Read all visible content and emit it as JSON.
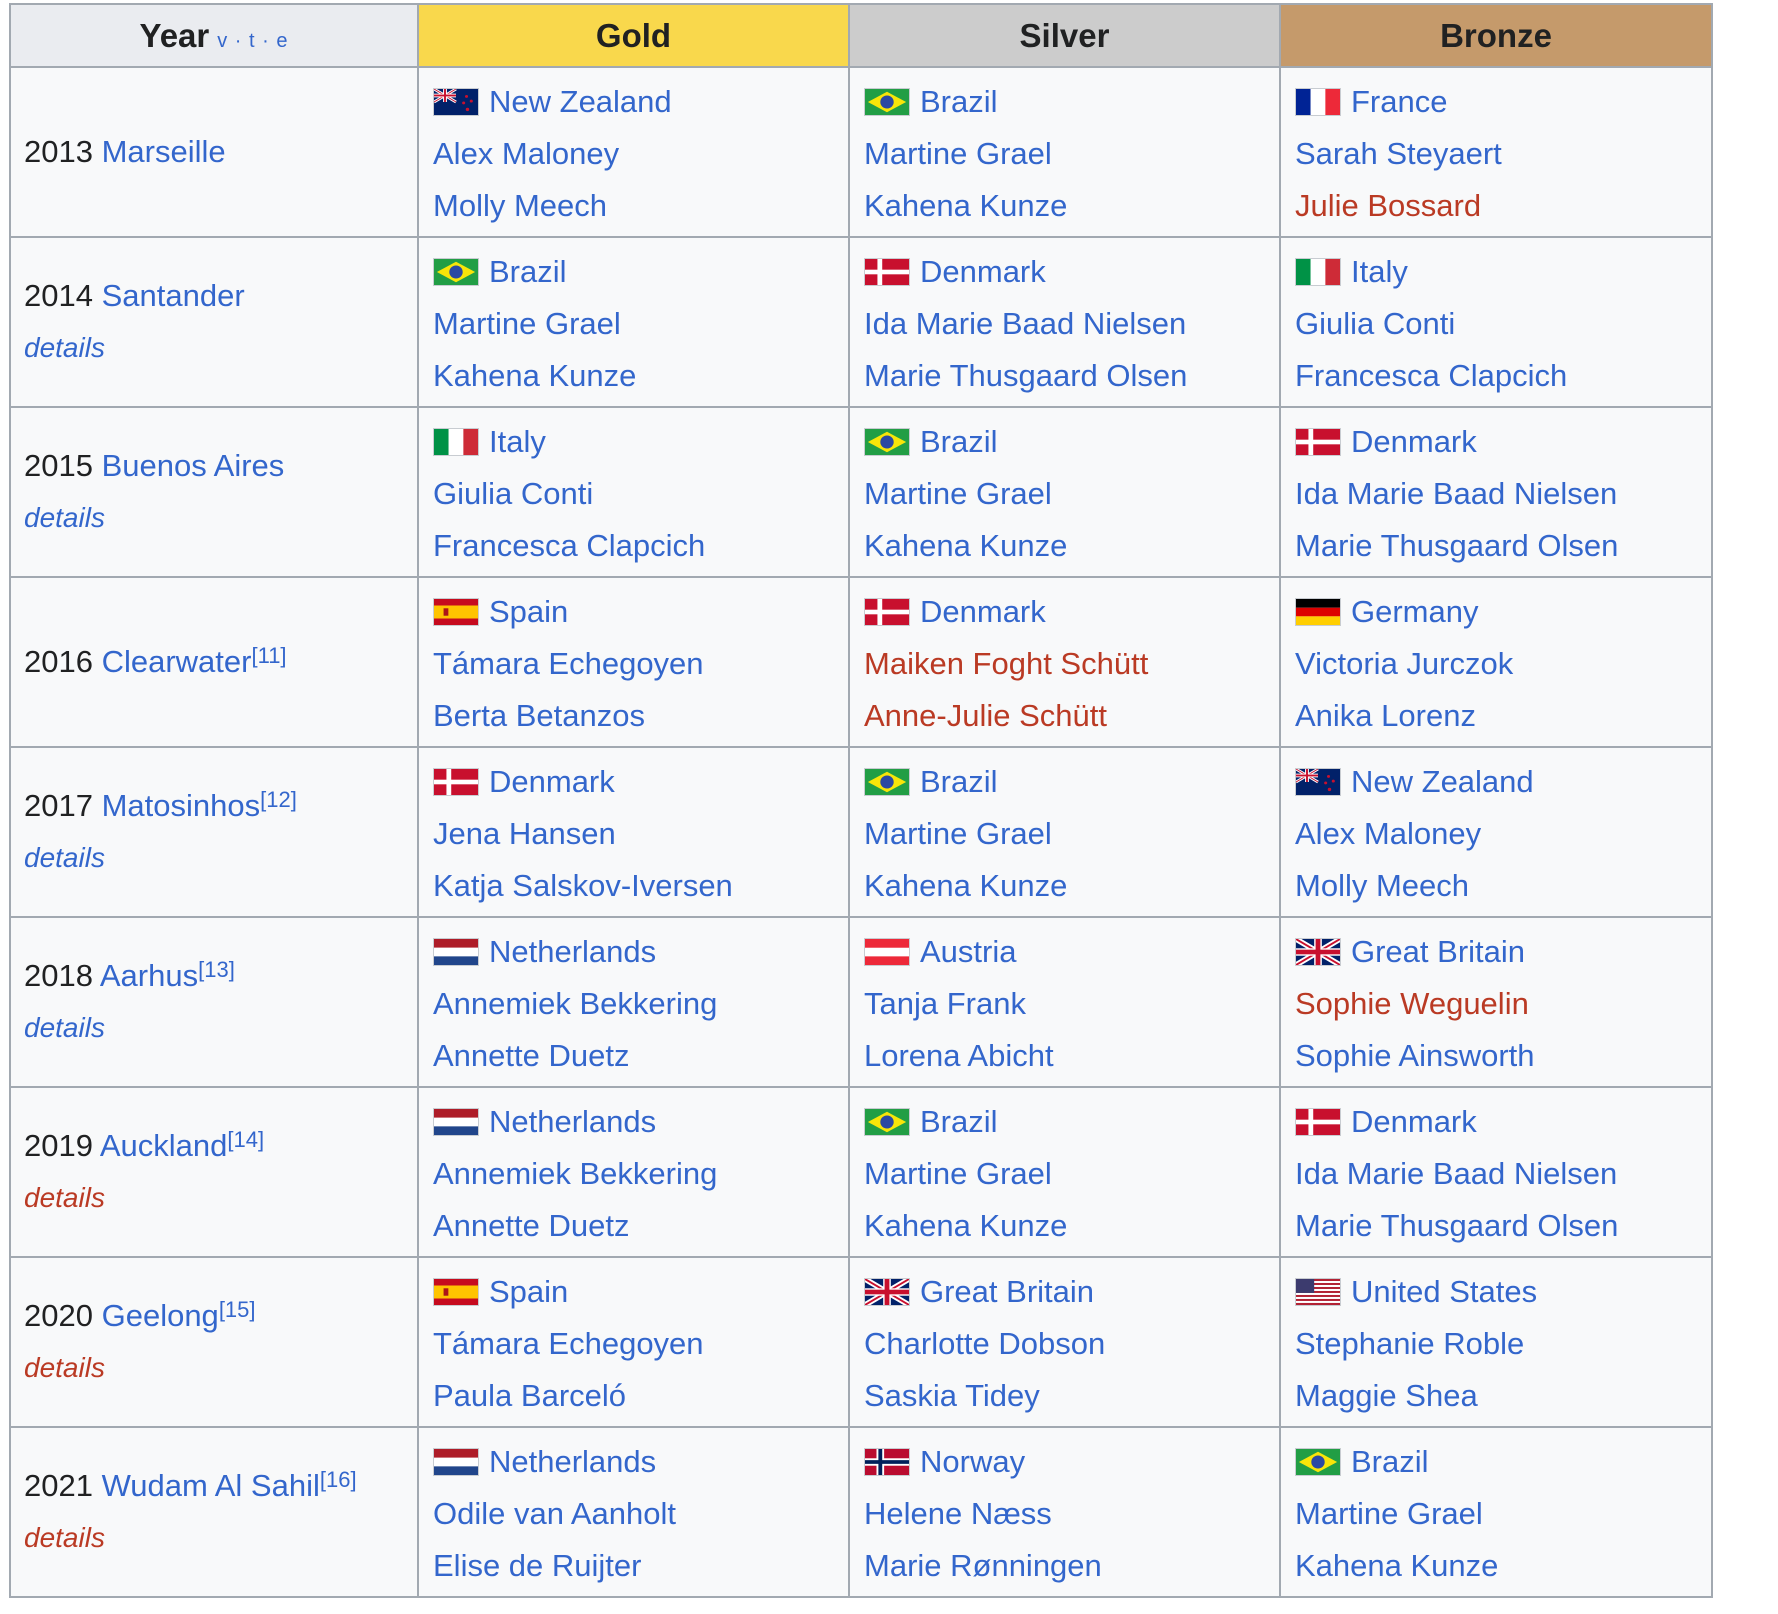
{
  "header": {
    "year": "Year",
    "vte": "v · t · e",
    "gold": "Gold",
    "silver": "Silver",
    "bronze": "Bronze"
  },
  "rows": [
    {
      "year": "2013",
      "city": "Marseille",
      "ref": "",
      "details": "",
      "details_red": false,
      "gold": {
        "country": "New Zealand",
        "flag": "new-zealand-flag",
        "a1": "Alex Maloney",
        "a2": "Molly Meech"
      },
      "silver": {
        "country": "Brazil",
        "flag": "brazil-flag",
        "a1": "Martine Grael",
        "a2": "Kahena Kunze"
      },
      "bronze": {
        "country": "France",
        "flag": "france-flag",
        "a1": "Sarah Steyaert",
        "a2": "Julie Bossard",
        "a2_red": true
      }
    },
    {
      "year": "2014",
      "city": "Santander",
      "ref": "",
      "details": "details",
      "details_red": false,
      "gold": {
        "country": "Brazil",
        "flag": "brazil-flag",
        "a1": "Martine Grael",
        "a2": "Kahena Kunze"
      },
      "silver": {
        "country": "Denmark",
        "flag": "denmark-flag",
        "a1": "Ida Marie Baad Nielsen",
        "a2": "Marie Thusgaard Olsen"
      },
      "bronze": {
        "country": "Italy",
        "flag": "italy-flag",
        "a1": "Giulia Conti",
        "a2": "Francesca Clapcich"
      }
    },
    {
      "year": "2015",
      "city": "Buenos Aires",
      "ref": "",
      "details": "details",
      "details_red": false,
      "gold": {
        "country": "Italy",
        "flag": "italy-flag",
        "a1": "Giulia Conti",
        "a2": "Francesca Clapcich"
      },
      "silver": {
        "country": "Brazil",
        "flag": "brazil-flag",
        "a1": "Martine Grael",
        "a2": "Kahena Kunze"
      },
      "bronze": {
        "country": "Denmark",
        "flag": "denmark-flag",
        "a1": "Ida Marie Baad Nielsen",
        "a2": "Marie Thusgaard Olsen"
      }
    },
    {
      "year": "2016",
      "city": "Clearwater",
      "ref": "[11]",
      "details": "",
      "details_red": false,
      "gold": {
        "country": "Spain",
        "flag": "spain-flag",
        "a1": "Támara Echegoyen",
        "a2": "Berta Betanzos"
      },
      "silver": {
        "country": "Denmark",
        "flag": "denmark-flag",
        "a1": "Maiken Foght Schütt",
        "a2": "Anne-Julie Schütt",
        "a1_red": true,
        "a2_red": true
      },
      "bronze": {
        "country": "Germany",
        "flag": "germany-flag",
        "a1": "Victoria Jurczok",
        "a2": "Anika Lorenz"
      }
    },
    {
      "year": "2017",
      "city": "Matosinhos",
      "ref": "[12]",
      "details": "details",
      "details_red": false,
      "gold": {
        "country": "Denmark",
        "flag": "denmark-flag",
        "a1": "Jena Hansen",
        "a2": "Katja Salskov-Iversen"
      },
      "silver": {
        "country": "Brazil",
        "flag": "brazil-flag",
        "a1": "Martine Grael",
        "a2": "Kahena Kunze"
      },
      "bronze": {
        "country": "New Zealand",
        "flag": "new-zealand-flag",
        "a1": "Alex Maloney",
        "a2": "Molly Meech"
      }
    },
    {
      "year": "2018",
      "city": "Aarhus",
      "ref": "[13]",
      "details": "details",
      "details_red": false,
      "gold": {
        "country": "Netherlands",
        "flag": "netherlands-flag",
        "a1": "Annemiek Bekkering",
        "a2": "Annette Duetz"
      },
      "silver": {
        "country": "Austria",
        "flag": "austria-flag",
        "a1": "Tanja Frank",
        "a2": "Lorena Abicht"
      },
      "bronze": {
        "country": "Great Britain",
        "flag": "great-britain-flag",
        "a1": "Sophie Weguelin",
        "a2": "Sophie Ainsworth",
        "a1_red": true
      }
    },
    {
      "year": "2019",
      "city": "Auckland",
      "ref": "[14]",
      "details": "details",
      "details_red": true,
      "gold": {
        "country": "Netherlands",
        "flag": "netherlands-flag",
        "a1": "Annemiek Bekkering",
        "a2": "Annette Duetz"
      },
      "silver": {
        "country": "Brazil",
        "flag": "brazil-flag",
        "a1": "Martine Grael",
        "a2": "Kahena Kunze"
      },
      "bronze": {
        "country": "Denmark",
        "flag": "denmark-flag",
        "a1": "Ida Marie Baad Nielsen",
        "a2": "Marie Thusgaard Olsen"
      }
    },
    {
      "year": "2020",
      "city": "Geelong",
      "ref": "[15]",
      "details": "details",
      "details_red": true,
      "gold": {
        "country": "Spain",
        "flag": "spain-flag",
        "a1": "Támara Echegoyen",
        "a2": "Paula Barceló"
      },
      "silver": {
        "country": "Great Britain",
        "flag": "great-britain-flag",
        "a1": "Charlotte Dobson",
        "a2": "Saskia Tidey"
      },
      "bronze": {
        "country": "United States",
        "flag": "united-states-flag",
        "a1": "Stephanie Roble",
        "a2": "Maggie Shea"
      }
    },
    {
      "year": "2021",
      "city": "Wudam Al Sahil",
      "ref": "[16]",
      "details": "details",
      "details_red": true,
      "gold": {
        "country": "Netherlands",
        "flag": "netherlands-flag",
        "a1": "Odile van Aanholt",
        "a2": "Elise de Ruijter"
      },
      "silver": {
        "country": "Norway",
        "flag": "norway-flag",
        "a1": "Helene Næss",
        "a2": "Marie Rønningen"
      },
      "bronze": {
        "country": "Brazil",
        "flag": "brazil-flag",
        "a1": "Martine Grael",
        "a2": "Kahena Kunze"
      }
    }
  ],
  "colors": {
    "link": "#3366cc",
    "redlink": "#ba3a24",
    "gold": "#f9d84c",
    "silver": "#cccccc",
    "bronze": "#c59a6b"
  }
}
